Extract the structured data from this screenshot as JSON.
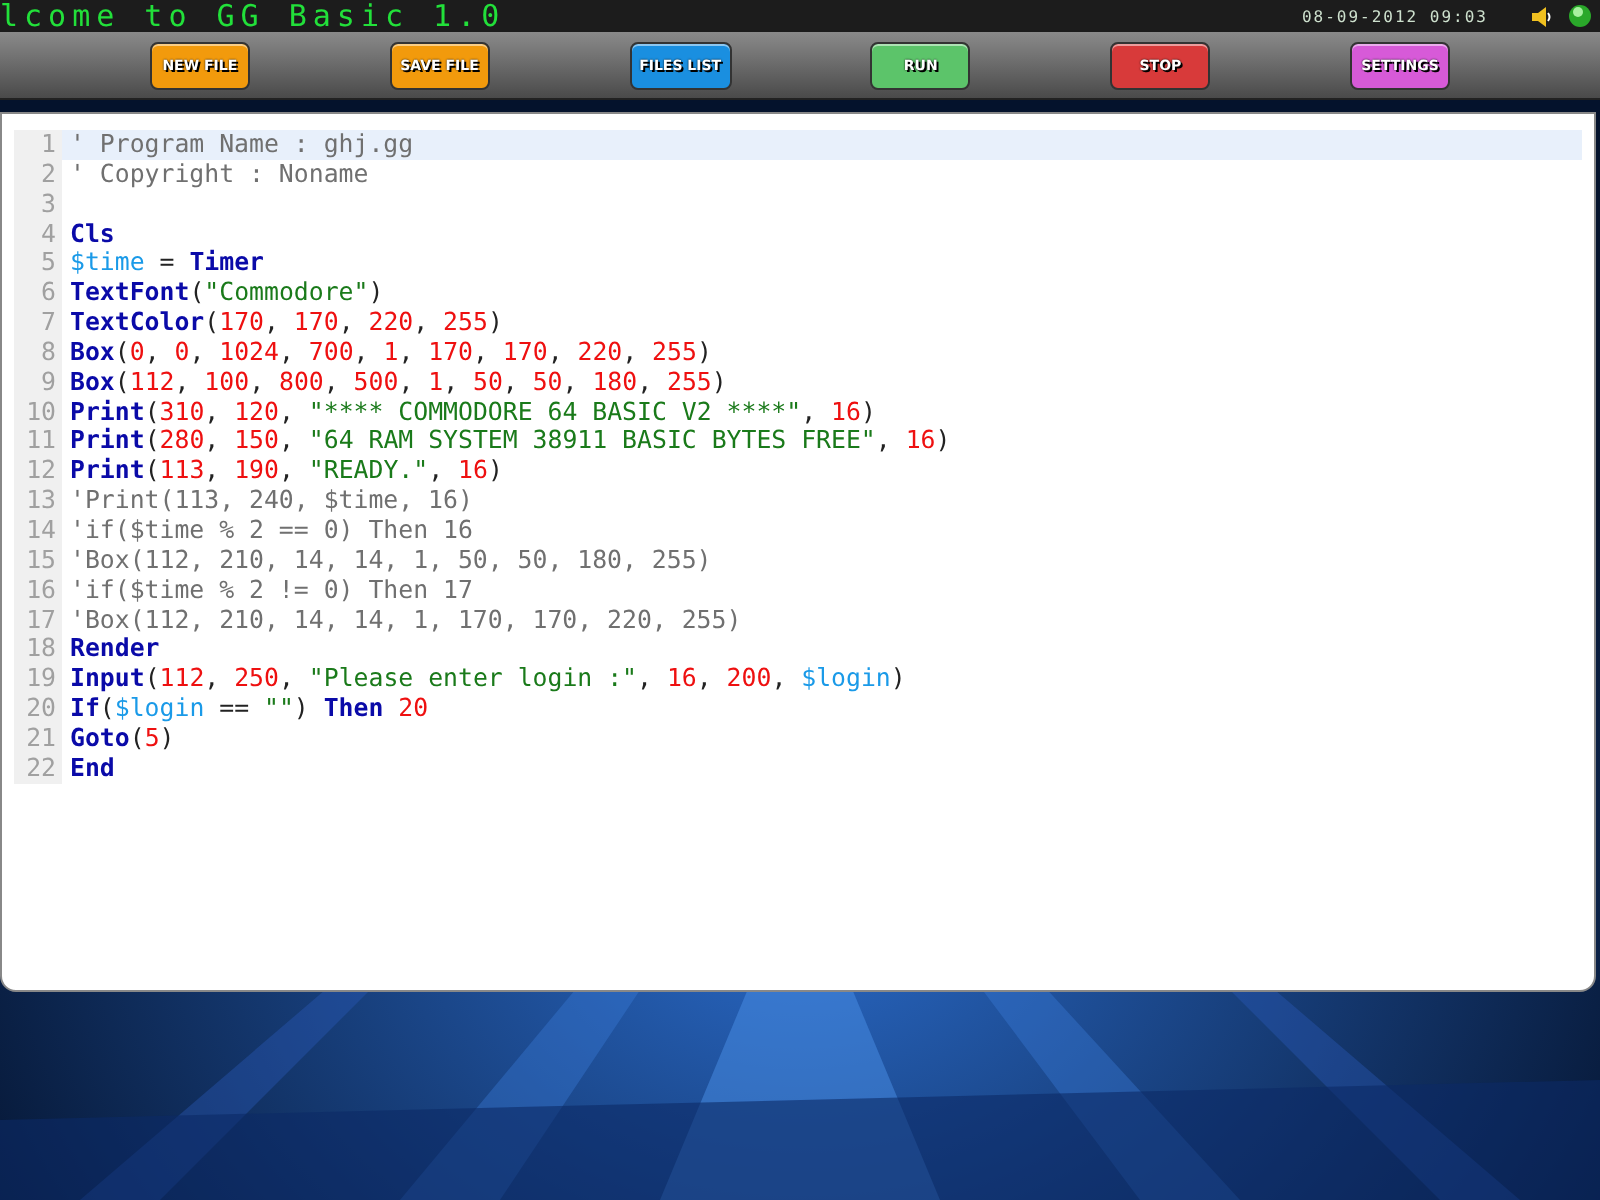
{
  "top_bar": {
    "marquee": "lcome to GG Basic 1.0",
    "datetime": "08-09-2012 09:03"
  },
  "toolbar": {
    "buttons": [
      {
        "label": "NEW FILE",
        "color": "#f29a0c"
      },
      {
        "label": "SAVE FILE",
        "color": "#f29a0c"
      },
      {
        "label": "FILES LIST",
        "color": "#1a8fe0"
      },
      {
        "label": "RUN",
        "color": "#5cc46a"
      },
      {
        "label": "STOP",
        "color": "#d83a3a"
      },
      {
        "label": "SETTINGS",
        "color": "#d75ad8"
      }
    ]
  },
  "editor": {
    "lines": [
      {
        "number": "1",
        "selected": true,
        "tokens": [
          {
            "kind": "comment",
            "text": "' Program Name : ghj.gg"
          }
        ]
      },
      {
        "number": "2",
        "selected": false,
        "tokens": [
          {
            "kind": "comment",
            "text": "' Copyright : Noname"
          }
        ]
      },
      {
        "number": "3",
        "selected": false
      },
      {
        "number": "4",
        "selected": false,
        "tokens": [
          {
            "kind": "keyword",
            "text": "Cls"
          }
        ]
      },
      {
        "number": "5",
        "selected": false,
        "tokens": [
          {
            "kind": "variable",
            "text": "$time"
          },
          {
            "kind": "plain",
            "text": " = "
          },
          {
            "kind": "keyword",
            "text": "Timer"
          }
        ]
      },
      {
        "number": "6",
        "selected": false,
        "tokens": [
          {
            "kind": "keyword",
            "text": "TextFont"
          },
          {
            "kind": "plain",
            "text": "("
          },
          {
            "kind": "string",
            "text": "\"Commodore\""
          },
          {
            "kind": "plain",
            "text": ")"
          }
        ]
      },
      {
        "number": "7",
        "selected": false,
        "tokens": [
          {
            "kind": "keyword",
            "text": "TextColor"
          },
          {
            "kind": "plain",
            "text": "("
          },
          {
            "kind": "number",
            "text": "170"
          },
          {
            "kind": "plain",
            "text": ", "
          },
          {
            "kind": "number",
            "text": "170"
          },
          {
            "kind": "plain",
            "text": ", "
          },
          {
            "kind": "number",
            "text": "220"
          },
          {
            "kind": "plain",
            "text": ", "
          },
          {
            "kind": "number",
            "text": "255"
          },
          {
            "kind": "plain",
            "text": ")"
          }
        ]
      },
      {
        "number": "8",
        "selected": false,
        "tokens": [
          {
            "kind": "keyword",
            "text": "Box"
          },
          {
            "kind": "plain",
            "text": "("
          },
          {
            "kind": "number",
            "text": "0"
          },
          {
            "kind": "plain",
            "text": ", "
          },
          {
            "kind": "number",
            "text": "0"
          },
          {
            "kind": "plain",
            "text": ", "
          },
          {
            "kind": "number",
            "text": "1024"
          },
          {
            "kind": "plain",
            "text": ", "
          },
          {
            "kind": "number",
            "text": "700"
          },
          {
            "kind": "plain",
            "text": ", "
          },
          {
            "kind": "number",
            "text": "1"
          },
          {
            "kind": "plain",
            "text": ", "
          },
          {
            "kind": "number",
            "text": "170"
          },
          {
            "kind": "plain",
            "text": ", "
          },
          {
            "kind": "number",
            "text": "170"
          },
          {
            "kind": "plain",
            "text": ", "
          },
          {
            "kind": "number",
            "text": "220"
          },
          {
            "kind": "plain",
            "text": ", "
          },
          {
            "kind": "number",
            "text": "255"
          },
          {
            "kind": "plain",
            "text": ")"
          }
        ]
      },
      {
        "number": "9",
        "selected": false,
        "tokens": [
          {
            "kind": "keyword",
            "text": "Box"
          },
          {
            "kind": "plain",
            "text": "("
          },
          {
            "kind": "number",
            "text": "112"
          },
          {
            "kind": "plain",
            "text": ", "
          },
          {
            "kind": "number",
            "text": "100"
          },
          {
            "kind": "plain",
            "text": ", "
          },
          {
            "kind": "number",
            "text": "800"
          },
          {
            "kind": "plain",
            "text": ", "
          },
          {
            "kind": "number",
            "text": "500"
          },
          {
            "kind": "plain",
            "text": ", "
          },
          {
            "kind": "number",
            "text": "1"
          },
          {
            "kind": "plain",
            "text": ", "
          },
          {
            "kind": "number",
            "text": "50"
          },
          {
            "kind": "plain",
            "text": ", "
          },
          {
            "kind": "number",
            "text": "50"
          },
          {
            "kind": "plain",
            "text": ", "
          },
          {
            "kind": "number",
            "text": "180"
          },
          {
            "kind": "plain",
            "text": ", "
          },
          {
            "kind": "number",
            "text": "255"
          },
          {
            "kind": "plain",
            "text": ")"
          }
        ]
      },
      {
        "number": "10",
        "selected": false,
        "tokens": [
          {
            "kind": "keyword",
            "text": "Print"
          },
          {
            "kind": "plain",
            "text": "("
          },
          {
            "kind": "number",
            "text": "310"
          },
          {
            "kind": "plain",
            "text": ", "
          },
          {
            "kind": "number",
            "text": "120"
          },
          {
            "kind": "plain",
            "text": ", "
          },
          {
            "kind": "string",
            "text": "\"**** COMMODORE 64 BASIC V2 ****\""
          },
          {
            "kind": "plain",
            "text": ", "
          },
          {
            "kind": "number",
            "text": "16"
          },
          {
            "kind": "plain",
            "text": ")"
          }
        ]
      },
      {
        "number": "11",
        "selected": false,
        "tokens": [
          {
            "kind": "keyword",
            "text": "Print"
          },
          {
            "kind": "plain",
            "text": "("
          },
          {
            "kind": "number",
            "text": "280"
          },
          {
            "kind": "plain",
            "text": ", "
          },
          {
            "kind": "number",
            "text": "150"
          },
          {
            "kind": "plain",
            "text": ", "
          },
          {
            "kind": "string",
            "text": "\"64 RAM SYSTEM 38911 BASIC BYTES FREE\""
          },
          {
            "kind": "plain",
            "text": ", "
          },
          {
            "kind": "number",
            "text": "16"
          },
          {
            "kind": "plain",
            "text": ")"
          }
        ]
      },
      {
        "number": "12",
        "selected": false,
        "tokens": [
          {
            "kind": "keyword",
            "text": "Print"
          },
          {
            "kind": "plain",
            "text": "("
          },
          {
            "kind": "number",
            "text": "113"
          },
          {
            "kind": "plain",
            "text": ", "
          },
          {
            "kind": "number",
            "text": "190"
          },
          {
            "kind": "plain",
            "text": ", "
          },
          {
            "kind": "string",
            "text": "\"READY.\""
          },
          {
            "kind": "plain",
            "text": ", "
          },
          {
            "kind": "number",
            "text": "16"
          },
          {
            "kind": "plain",
            "text": ")"
          }
        ]
      },
      {
        "number": "13",
        "selected": false,
        "tokens": [
          {
            "kind": "comment",
            "text": "'Print(113, 240, $time, 16)"
          }
        ]
      },
      {
        "number": "14",
        "selected": false,
        "tokens": [
          {
            "kind": "comment",
            "text": "'if($time % 2 == 0) Then 16"
          }
        ]
      },
      {
        "number": "15",
        "selected": false,
        "tokens": [
          {
            "kind": "comment",
            "text": "'Box(112, 210, 14, 14, 1, 50, 50, 180, 255)"
          }
        ]
      },
      {
        "number": "16",
        "selected": false,
        "tokens": [
          {
            "kind": "comment",
            "text": "'if($time % 2 != 0) Then 17"
          }
        ]
      },
      {
        "number": "17",
        "selected": false,
        "tokens": [
          {
            "kind": "comment",
            "text": "'Box(112, 210, 14, 14, 1, 170, 170, 220, 255)"
          }
        ]
      },
      {
        "number": "18",
        "selected": false,
        "tokens": [
          {
            "kind": "keyword",
            "text": "Render"
          }
        ]
      },
      {
        "number": "19",
        "selected": false,
        "tokens": [
          {
            "kind": "keyword",
            "text": "Input"
          },
          {
            "kind": "plain",
            "text": "("
          },
          {
            "kind": "number",
            "text": "112"
          },
          {
            "kind": "plain",
            "text": ", "
          },
          {
            "kind": "number",
            "text": "250"
          },
          {
            "kind": "plain",
            "text": ", "
          },
          {
            "kind": "string",
            "text": "\"Please enter login :\""
          },
          {
            "kind": "plain",
            "text": ", "
          },
          {
            "kind": "number",
            "text": "16"
          },
          {
            "kind": "plain",
            "text": ", "
          },
          {
            "kind": "number",
            "text": "200"
          },
          {
            "kind": "plain",
            "text": ", "
          },
          {
            "kind": "variable",
            "text": "$login"
          },
          {
            "kind": "plain",
            "text": ")"
          }
        ]
      },
      {
        "number": "20",
        "selected": false,
        "tokens": [
          {
            "kind": "keyword",
            "text": "If"
          },
          {
            "kind": "plain",
            "text": "("
          },
          {
            "kind": "variable",
            "text": "$login"
          },
          {
            "kind": "plain",
            "text": " == "
          },
          {
            "kind": "string",
            "text": "\"\""
          },
          {
            "kind": "plain",
            "text": ") "
          },
          {
            "kind": "keyword",
            "text": "Then"
          },
          {
            "kind": "number",
            "text": " 20"
          }
        ]
      },
      {
        "number": "21",
        "selected": false,
        "tokens": [
          {
            "kind": "keyword",
            "text": "Goto"
          },
          {
            "kind": "plain",
            "text": "("
          },
          {
            "kind": "number",
            "text": "5"
          },
          {
            "kind": "plain",
            "text": ")"
          }
        ]
      },
      {
        "number": "22",
        "selected": false,
        "tokens": [
          {
            "kind": "keyword",
            "text": "End"
          }
        ]
      }
    ]
  }
}
